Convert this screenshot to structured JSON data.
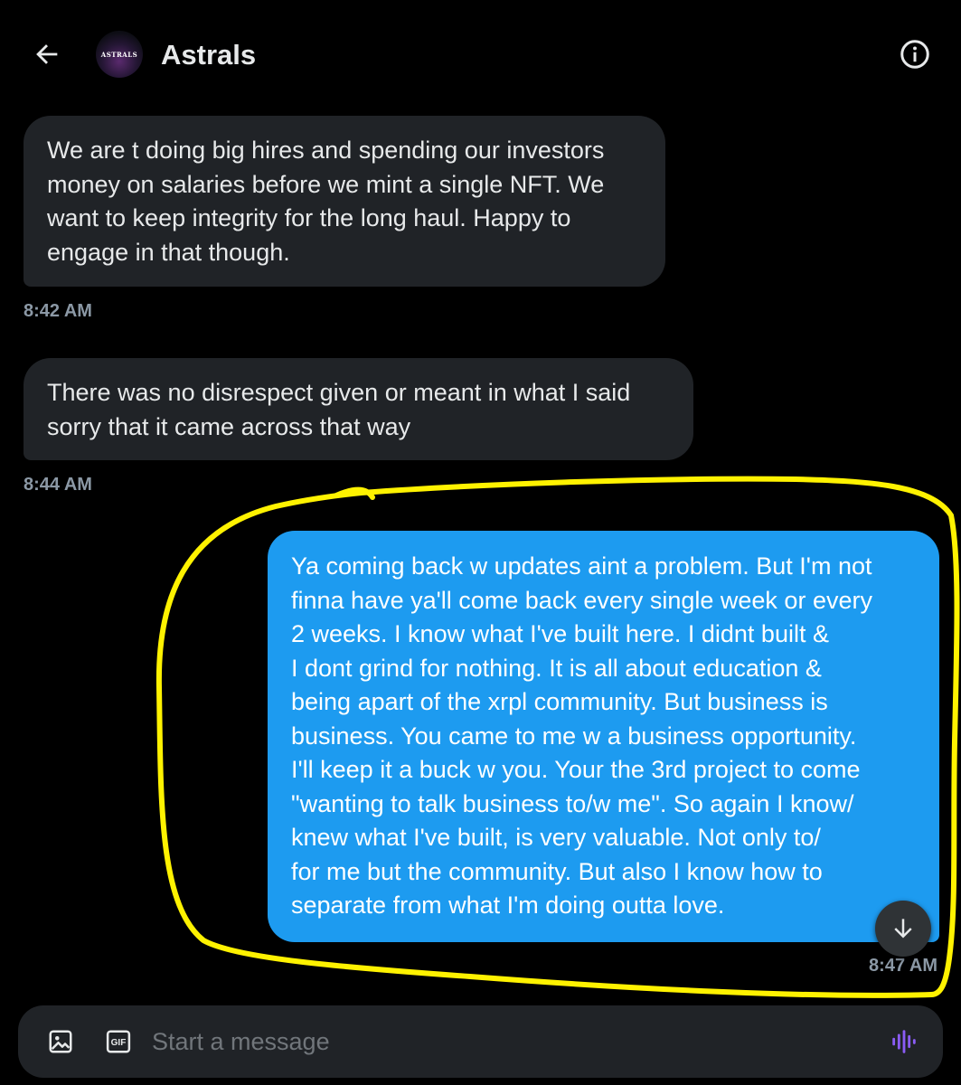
{
  "header": {
    "title": "Astrals",
    "avatar_text": "ASTRALS"
  },
  "icons": {
    "back": "arrow-left-icon",
    "info": "info-icon",
    "scroll_down": "arrow-down-icon",
    "media": "image-icon",
    "gif": "gif-icon",
    "voice": "voice-icon"
  },
  "colors": {
    "background": "#000000",
    "incoming_bubble": "#202327",
    "outgoing_bubble": "#1d9bf0",
    "timestamp": "#8b98a5",
    "highlight": "#fff200",
    "voice_accent": "#8b5cf6"
  },
  "messages": [
    {
      "direction": "incoming",
      "text": "We are t doing big hires and spending our investors\nmoney on salaries before we mint a single NFT. We\nwant to keep integrity for the long haul. Happy to\nengage in that though.",
      "time": "8:42 AM"
    },
    {
      "direction": "incoming",
      "text": "There was no disrespect given or meant in what I said\nsorry that it came across that way",
      "time": "8:44 AM"
    },
    {
      "direction": "outgoing",
      "text": "Ya coming back w updates aint a problem. But I'm not\nfinna have ya'll come back every single week or every\n2 weeks. I know what I've built here. I didnt built &\nI dont grind for nothing. It is all about education &\nbeing apart of the xrpl community. But business is\nbusiness. You came to me w a business opportunity.\nI'll keep it a buck w you. Your the 3rd project to come\n\"wanting to talk business to/w me\". So again I know/\nknew what I've built, is very valuable. Not only to/\nfor me but the community. But also I know how to\nseparate from what I'm doing outta love.",
      "time": "8:47 AM"
    }
  ],
  "composer": {
    "placeholder": "Start a message",
    "value": "",
    "gif_label": "GIF"
  }
}
